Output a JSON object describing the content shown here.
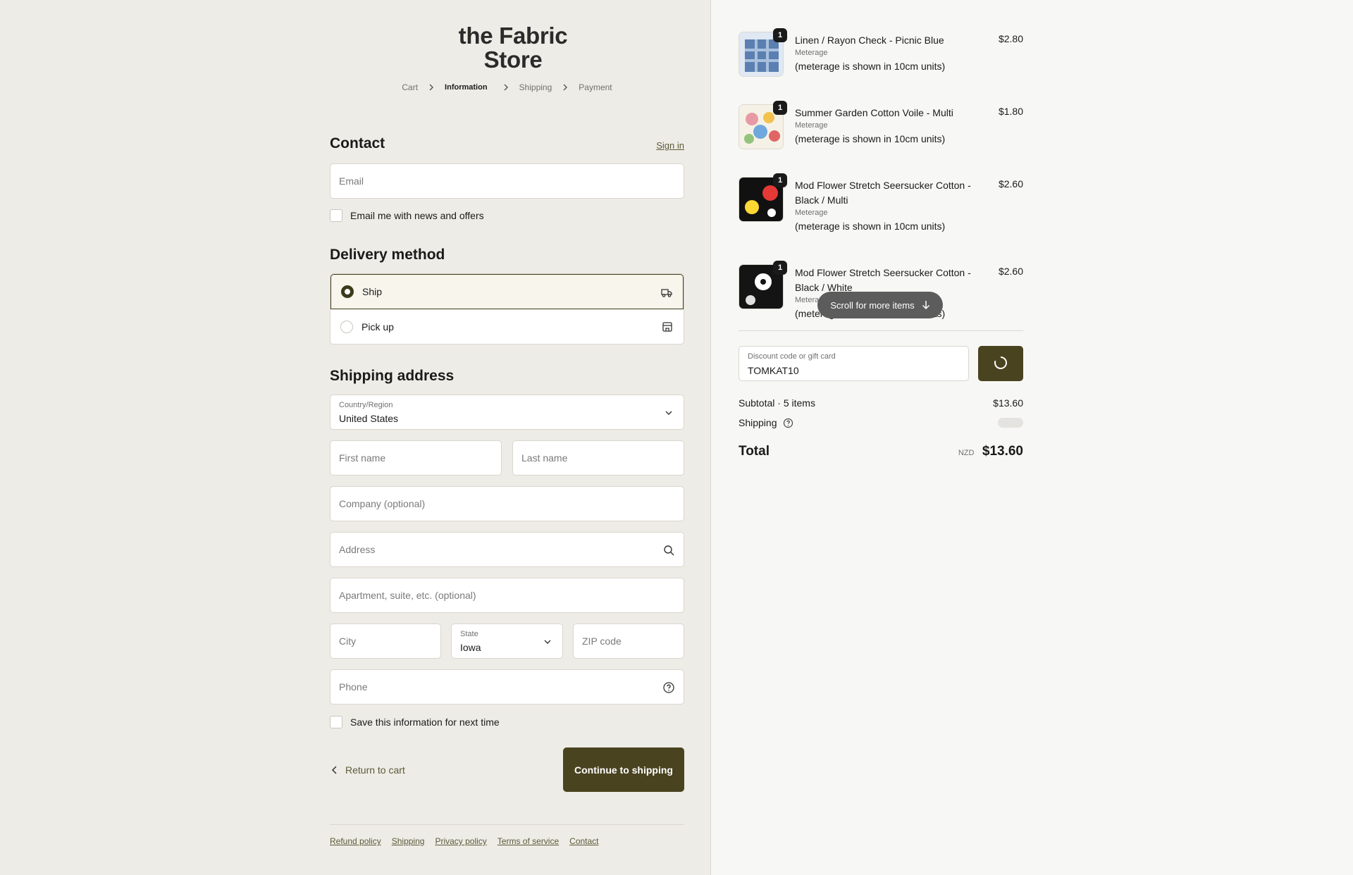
{
  "store": {
    "logo_line1": "the Fabric",
    "logo_line2": "Store"
  },
  "breadcrumb": [
    "Cart",
    "Information",
    "Shipping",
    "Payment"
  ],
  "contact": {
    "heading": "Contact",
    "sign_in": "Sign in",
    "email_placeholder": "Email",
    "newsletter_label": "Email me with news and offers"
  },
  "delivery": {
    "heading": "Delivery method",
    "options": [
      {
        "label": "Ship",
        "selected": true,
        "icon": "truck-icon"
      },
      {
        "label": "Pick up",
        "selected": false,
        "icon": "store-icon"
      }
    ]
  },
  "shipping": {
    "heading": "Shipping address",
    "country_label": "Country/Region",
    "country_value": "United States",
    "first_name": "First name",
    "last_name": "Last name",
    "company": "Company (optional)",
    "address": "Address",
    "apartment": "Apartment, suite, etc. (optional)",
    "city": "City",
    "state_label": "State",
    "state_value": "Iowa",
    "zip": "ZIP code",
    "phone": "Phone",
    "save_label": "Save this information for next time"
  },
  "actions": {
    "return": "Return to cart",
    "continue": "Continue to shipping"
  },
  "footer": [
    "Refund policy",
    "Shipping",
    "Privacy policy",
    "Terms of service",
    "Contact"
  ],
  "cart": {
    "items": [
      {
        "qty": "1",
        "name": "Linen / Rayon Check - Picnic Blue",
        "variant": "Meterage",
        "note": "(meterage is shown in 10cm units)",
        "price": "$2.80",
        "swatch": "#5b7fb0"
      },
      {
        "qty": "1",
        "name": "Summer Garden Cotton Voile - Multi",
        "variant": "Meterage",
        "note": "(meterage is shown in 10cm units)",
        "price": "$1.80",
        "swatch": "#e79aa3"
      },
      {
        "qty": "1",
        "name": "Mod Flower Stretch Seersucker Cotton - Black / Multi",
        "variant": "Meterage",
        "note": "(meterage is shown in 10cm units)",
        "price": "$2.60",
        "swatch": "#111111"
      },
      {
        "qty": "1",
        "name": "Mod Flower Stretch Seersucker Cotton - Black / White",
        "variant": "Meterage",
        "note": "(meterage is shown in 10cm units)",
        "price": "$2.60",
        "swatch": "#141414"
      }
    ],
    "scroll_hint": "Scroll for more items",
    "discount_label": "Discount code or gift card",
    "discount_value": "TOMKAT10",
    "subtotal_label": "Subtotal · 5 items",
    "subtotal_value": "$13.60",
    "shipping_label": "Shipping",
    "total_label": "Total",
    "currency": "NZD",
    "total_value": "$13.60"
  },
  "colors": {
    "accent": "#4a4320",
    "left_bg": "#eeece6",
    "right_bg": "#f7f7f5"
  }
}
